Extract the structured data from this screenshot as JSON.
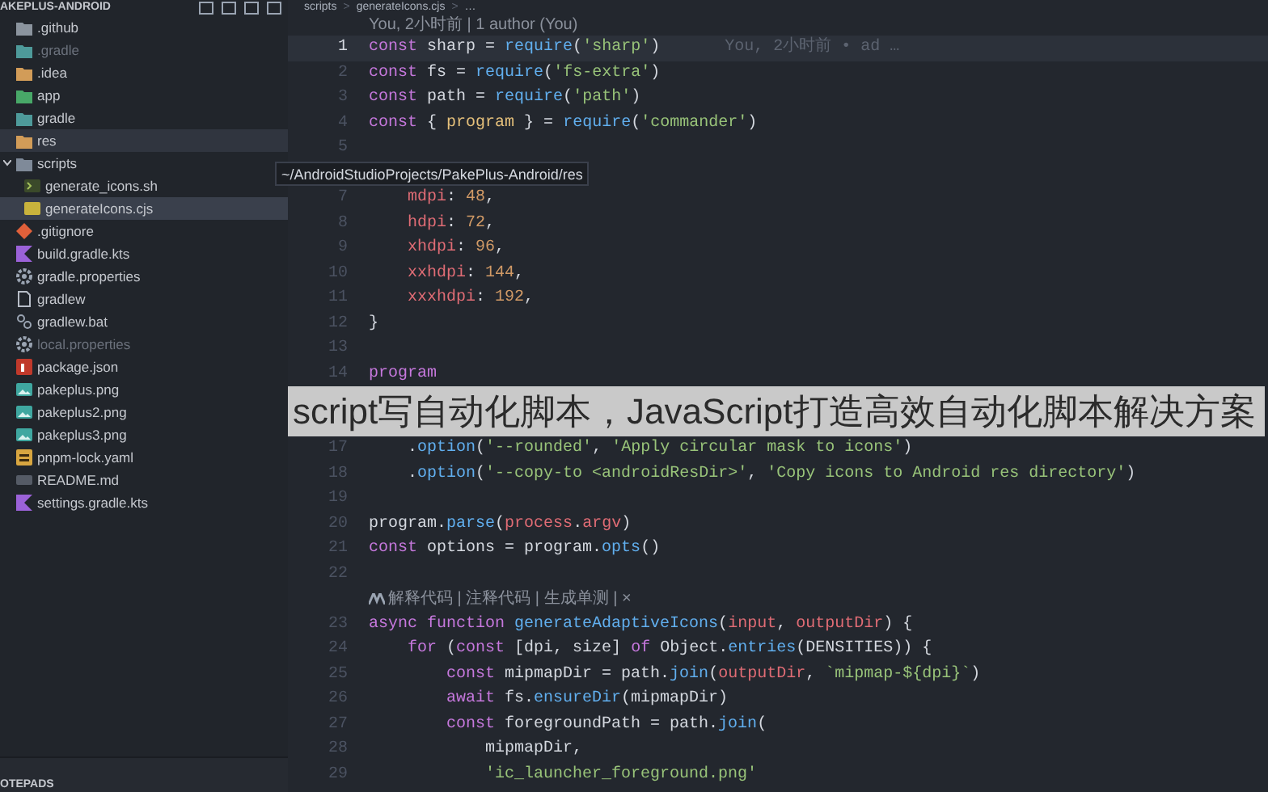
{
  "sidebar": {
    "header": "AKEPLUS-ANDROID",
    "items": [
      {
        "kind": "folder-github",
        "name": ".github",
        "selected": false,
        "hovered": false,
        "ignored": false,
        "expanded": false
      },
      {
        "kind": "folder-teal",
        "name": ".gradle",
        "selected": false,
        "hovered": false,
        "ignored": true,
        "expanded": false
      },
      {
        "kind": "folder-orange",
        "name": ".idea",
        "selected": false,
        "hovered": false,
        "ignored": false,
        "expanded": false
      },
      {
        "kind": "folder-green",
        "name": "app",
        "selected": false,
        "hovered": false,
        "ignored": false,
        "expanded": false
      },
      {
        "kind": "folder-teal",
        "name": "gradle",
        "selected": false,
        "hovered": false,
        "ignored": false,
        "expanded": false
      },
      {
        "kind": "folder-orange",
        "name": "res",
        "selected": false,
        "hovered": true,
        "ignored": false,
        "expanded": false
      },
      {
        "kind": "folder-gray",
        "name": "scripts",
        "selected": false,
        "hovered": false,
        "ignored": false,
        "expanded": true,
        "children": [
          {
            "kind": "shell",
            "name": "generate_icons.sh",
            "selected": false,
            "hovered": false,
            "ignored": false
          },
          {
            "kind": "js",
            "name": "generateIcons.cjs",
            "selected": true,
            "hovered": false,
            "ignored": false
          }
        ]
      },
      {
        "kind": "git",
        "name": ".gitignore",
        "selected": false,
        "hovered": false,
        "ignored": false
      },
      {
        "kind": "kotlin",
        "name": "build.gradle.kts",
        "selected": false,
        "hovered": false,
        "ignored": false
      },
      {
        "kind": "gear",
        "name": "gradle.properties",
        "selected": false,
        "hovered": false,
        "ignored": false
      },
      {
        "kind": "file",
        "name": "gradlew",
        "selected": false,
        "hovered": false,
        "ignored": false
      },
      {
        "kind": "link",
        "name": "gradlew.bat",
        "selected": false,
        "hovered": false,
        "ignored": false
      },
      {
        "kind": "gear",
        "name": "local.properties",
        "selected": false,
        "hovered": false,
        "ignored": true
      },
      {
        "kind": "npm",
        "name": "package.json",
        "selected": false,
        "hovered": false,
        "ignored": false
      },
      {
        "kind": "image",
        "name": "pakeplus.png",
        "selected": false,
        "hovered": false,
        "ignored": false
      },
      {
        "kind": "image",
        "name": "pakeplus2.png",
        "selected": false,
        "hovered": false,
        "ignored": false
      },
      {
        "kind": "image",
        "name": "pakeplus3.png",
        "selected": false,
        "hovered": false,
        "ignored": false
      },
      {
        "kind": "yaml",
        "name": "pnpm-lock.yaml",
        "selected": false,
        "hovered": false,
        "ignored": false
      },
      {
        "kind": "markdown",
        "name": "README.md",
        "selected": false,
        "hovered": false,
        "ignored": false
      },
      {
        "kind": "kotlin",
        "name": "settings.gradle.kts",
        "selected": false,
        "hovered": false,
        "ignored": false
      }
    ],
    "bottom_panel": "OTEPADS"
  },
  "editor": {
    "breadcrumb": [
      {
        "kind": "item",
        "text": "scripts"
      },
      {
        "kind": "separator",
        "text": ">"
      },
      {
        "kind": "item",
        "text": "generateIcons.cjs"
      },
      {
        "kind": "separator",
        "text": ">"
      },
      {
        "kind": "item",
        "text": "…"
      }
    ],
    "author_lens": "You, 2小时前 | 1 author (You)",
    "rows": [
      {
        "kind": "code",
        "number": "1",
        "current": true,
        "blame": "You, 2小时前 • ad …",
        "tokens": [
          {
            "kind": "keyword",
            "text": "const"
          },
          {
            "kind": "plain",
            "text": " sharp = "
          },
          {
            "kind": "function",
            "text": "require"
          },
          {
            "kind": "plain",
            "text": "("
          },
          {
            "kind": "string",
            "text": "'sharp'"
          },
          {
            "kind": "plain",
            "text": ")"
          }
        ]
      },
      {
        "kind": "code",
        "number": "2",
        "current": false,
        "tokens": [
          {
            "kind": "keyword",
            "text": "const"
          },
          {
            "kind": "plain",
            "text": " fs = "
          },
          {
            "kind": "function",
            "text": "require"
          },
          {
            "kind": "plain",
            "text": "("
          },
          {
            "kind": "string",
            "text": "'fs-extra'"
          },
          {
            "kind": "plain",
            "text": ")"
          }
        ]
      },
      {
        "kind": "code",
        "number": "3",
        "current": false,
        "tokens": [
          {
            "kind": "keyword",
            "text": "const"
          },
          {
            "kind": "plain",
            "text": " path = "
          },
          {
            "kind": "function",
            "text": "require"
          },
          {
            "kind": "plain",
            "text": "("
          },
          {
            "kind": "string",
            "text": "'path'"
          },
          {
            "kind": "plain",
            "text": ")"
          }
        ]
      },
      {
        "kind": "code",
        "number": "4",
        "current": false,
        "tokens": [
          {
            "kind": "keyword",
            "text": "const"
          },
          {
            "kind": "plain",
            "text": " { "
          },
          {
            "kind": "variable",
            "text": "program"
          },
          {
            "kind": "plain",
            "text": " } = "
          },
          {
            "kind": "function",
            "text": "require"
          },
          {
            "kind": "plain",
            "text": "("
          },
          {
            "kind": "string",
            "text": "'commander'"
          },
          {
            "kind": "plain",
            "text": ")"
          }
        ]
      },
      {
        "kind": "code",
        "number": "5",
        "current": false,
        "tokens": []
      },
      {
        "kind": "tooltip",
        "text": "~/AndroidStudioProjects/PakePlus-Android/res"
      },
      {
        "kind": "code",
        "number": "7",
        "current": false,
        "tokens": [
          {
            "kind": "property",
            "text": "    mdpi"
          },
          {
            "kind": "plain",
            "text": ": "
          },
          {
            "kind": "number",
            "text": "48"
          },
          {
            "kind": "plain",
            "text": ","
          }
        ]
      },
      {
        "kind": "code",
        "number": "8",
        "current": false,
        "tokens": [
          {
            "kind": "property",
            "text": "    hdpi"
          },
          {
            "kind": "plain",
            "text": ": "
          },
          {
            "kind": "number",
            "text": "72"
          },
          {
            "kind": "plain",
            "text": ","
          }
        ]
      },
      {
        "kind": "code",
        "number": "9",
        "current": false,
        "tokens": [
          {
            "kind": "property",
            "text": "    xhdpi"
          },
          {
            "kind": "plain",
            "text": ": "
          },
          {
            "kind": "number",
            "text": "96"
          },
          {
            "kind": "plain",
            "text": ","
          }
        ]
      },
      {
        "kind": "code",
        "number": "10",
        "current": false,
        "tokens": [
          {
            "kind": "property",
            "text": "    xxhdpi"
          },
          {
            "kind": "plain",
            "text": ": "
          },
          {
            "kind": "number",
            "text": "144"
          },
          {
            "kind": "plain",
            "text": ","
          }
        ]
      },
      {
        "kind": "code",
        "number": "11",
        "current": false,
        "tokens": [
          {
            "kind": "property",
            "text": "    xxxhdpi"
          },
          {
            "kind": "plain",
            "text": ": "
          },
          {
            "kind": "number",
            "text": "192"
          },
          {
            "kind": "plain",
            "text": ","
          }
        ]
      },
      {
        "kind": "code",
        "number": "12",
        "current": false,
        "tokens": [
          {
            "kind": "plain",
            "text": "}"
          }
        ]
      },
      {
        "kind": "code",
        "number": "13",
        "current": false,
        "tokens": []
      },
      {
        "kind": "code",
        "number": "14",
        "current": false,
        "tokens": [
          {
            "kind": "keyword",
            "text": "program"
          }
        ]
      },
      {
        "kind": "covered"
      },
      {
        "kind": "covered"
      },
      {
        "kind": "code",
        "number": "17",
        "current": false,
        "tokens": [
          {
            "kind": "plain",
            "text": "    ."
          },
          {
            "kind": "function",
            "text": "option"
          },
          {
            "kind": "plain",
            "text": "("
          },
          {
            "kind": "string",
            "text": "'--rounded'"
          },
          {
            "kind": "plain",
            "text": ", "
          },
          {
            "kind": "string",
            "text": "'Apply circular mask to icons'"
          },
          {
            "kind": "plain",
            "text": ")"
          }
        ]
      },
      {
        "kind": "code",
        "number": "18",
        "current": false,
        "tokens": [
          {
            "kind": "plain",
            "text": "    ."
          },
          {
            "kind": "function",
            "text": "option"
          },
          {
            "kind": "plain",
            "text": "("
          },
          {
            "kind": "string",
            "text": "'--copy-to <androidResDir>'"
          },
          {
            "kind": "plain",
            "text": ", "
          },
          {
            "kind": "string",
            "text": "'Copy icons to Android res directory'"
          },
          {
            "kind": "plain",
            "text": ")"
          }
        ]
      },
      {
        "kind": "code",
        "number": "19",
        "current": false,
        "tokens": []
      },
      {
        "kind": "code",
        "number": "20",
        "current": false,
        "tokens": [
          {
            "kind": "plain",
            "text": "program."
          },
          {
            "kind": "function",
            "text": "parse"
          },
          {
            "kind": "plain",
            "text": "("
          },
          {
            "kind": "property",
            "text": "process"
          },
          {
            "kind": "plain",
            "text": "."
          },
          {
            "kind": "property",
            "text": "argv"
          },
          {
            "kind": "plain",
            "text": ")"
          }
        ]
      },
      {
        "kind": "code",
        "number": "21",
        "current": false,
        "tokens": [
          {
            "kind": "keyword",
            "text": "const"
          },
          {
            "kind": "plain",
            "text": " options = program."
          },
          {
            "kind": "function",
            "text": "opts"
          },
          {
            "kind": "plain",
            "text": "()"
          }
        ]
      },
      {
        "kind": "code",
        "number": "22",
        "current": false,
        "tokens": []
      },
      {
        "kind": "lens",
        "text": "解释代码 | 注释代码 | 生成单测 | ×"
      },
      {
        "kind": "code",
        "number": "23",
        "current": false,
        "tokens": [
          {
            "kind": "keyword",
            "text": "async function"
          },
          {
            "kind": "function",
            "text": " generateAdaptiveIcons"
          },
          {
            "kind": "plain",
            "text": "("
          },
          {
            "kind": "property",
            "text": "input"
          },
          {
            "kind": "plain",
            "text": ", "
          },
          {
            "kind": "property",
            "text": "outputDir"
          },
          {
            "kind": "plain",
            "text": ") {"
          }
        ]
      },
      {
        "kind": "code",
        "number": "24",
        "current": false,
        "tokens": [
          {
            "kind": "keyword",
            "text": "    for"
          },
          {
            "kind": "plain",
            "text": " ("
          },
          {
            "kind": "keyword",
            "text": "const"
          },
          {
            "kind": "plain",
            "text": " [dpi, size] "
          },
          {
            "kind": "keyword",
            "text": "of"
          },
          {
            "kind": "plain",
            "text": " Object."
          },
          {
            "kind": "function",
            "text": "entries"
          },
          {
            "kind": "plain",
            "text": "(DENSITIES)) {"
          }
        ]
      },
      {
        "kind": "code",
        "number": "25",
        "current": false,
        "tokens": [
          {
            "kind": "keyword",
            "text": "        const"
          },
          {
            "kind": "plain",
            "text": " mipmapDir = path."
          },
          {
            "kind": "function",
            "text": "join"
          },
          {
            "kind": "plain",
            "text": "("
          },
          {
            "kind": "property",
            "text": "outputDir"
          },
          {
            "kind": "plain",
            "text": ", "
          },
          {
            "kind": "string",
            "text": "`mipmap-${dpi}`"
          },
          {
            "kind": "plain",
            "text": ")"
          }
        ]
      },
      {
        "kind": "code",
        "number": "26",
        "current": false,
        "tokens": [
          {
            "kind": "keyword",
            "text": "        await"
          },
          {
            "kind": "plain",
            "text": " fs."
          },
          {
            "kind": "function",
            "text": "ensureDir"
          },
          {
            "kind": "plain",
            "text": "(mipmapDir)"
          }
        ]
      },
      {
        "kind": "code",
        "number": "27",
        "current": false,
        "tokens": [
          {
            "kind": "keyword",
            "text": "        const"
          },
          {
            "kind": "plain",
            "text": " foregroundPath = path."
          },
          {
            "kind": "function",
            "text": "join"
          },
          {
            "kind": "plain",
            "text": "("
          }
        ]
      },
      {
        "kind": "code",
        "number": "28",
        "current": false,
        "tokens": [
          {
            "kind": "plain",
            "text": "            mipmapDir,"
          }
        ]
      },
      {
        "kind": "code",
        "number": "29",
        "current": false,
        "tokens": [
          {
            "kind": "string",
            "text": "            'ic_launcher_foreground.png'"
          }
        ]
      }
    ]
  },
  "caption": "script写自动化脚本，JavaScript打造高效自动化脚本解决方案"
}
